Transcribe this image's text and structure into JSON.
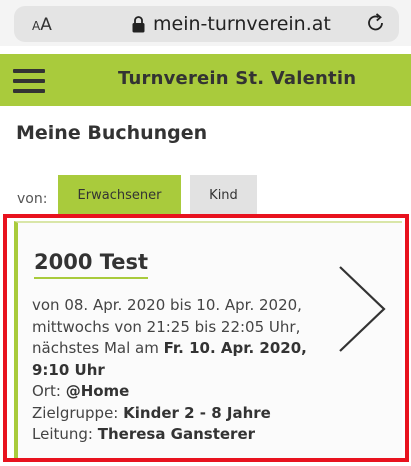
{
  "browser": {
    "text_size_label_small": "A",
    "text_size_label_large": "A",
    "url": "mein-turnverein.at"
  },
  "header": {
    "title": "Turnverein St. Valentin"
  },
  "page": {
    "title": "Meine Buchungen"
  },
  "filter": {
    "label": "von:",
    "tabs": [
      {
        "label": "Erwachsener",
        "active": true
      },
      {
        "label": "Kind",
        "active": false
      }
    ]
  },
  "booking": {
    "title": "2000 Test",
    "date_range": "von 08. Apr. 2020 bis 10. Apr. 2020,",
    "schedule": "mittwochs von 21:25 bis 22:05 Uhr,",
    "next_prefix": "nächstes Mal am ",
    "next_date": "Fr. 10. Apr. 2020,",
    "next_time": "9:10 Uhr",
    "location_label": "Ort: ",
    "location": "@Home",
    "target_label": "Zielgruppe: ",
    "target": "Kinder 2 - 8 Jahre",
    "leader_label": "Leitung: ",
    "leader": "Theresa Gansterer"
  },
  "colors": {
    "brand": "#a9cb3c",
    "highlight": "#e8121e"
  }
}
